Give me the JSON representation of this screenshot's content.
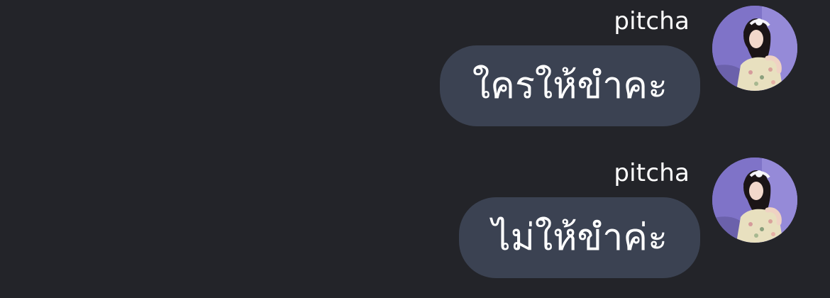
{
  "messages": [
    {
      "sender": "pitcha",
      "text": "ใครให้ขำคะ",
      "avatar_icon": "profile-photo-avatar"
    },
    {
      "sender": "pitcha",
      "text": "ไม่ให้ขำค่ะ",
      "avatar_icon": "profile-photo-avatar"
    }
  ],
  "colors": {
    "background": "#232429",
    "bubble": "#3b4252",
    "text": "#ffffff"
  }
}
